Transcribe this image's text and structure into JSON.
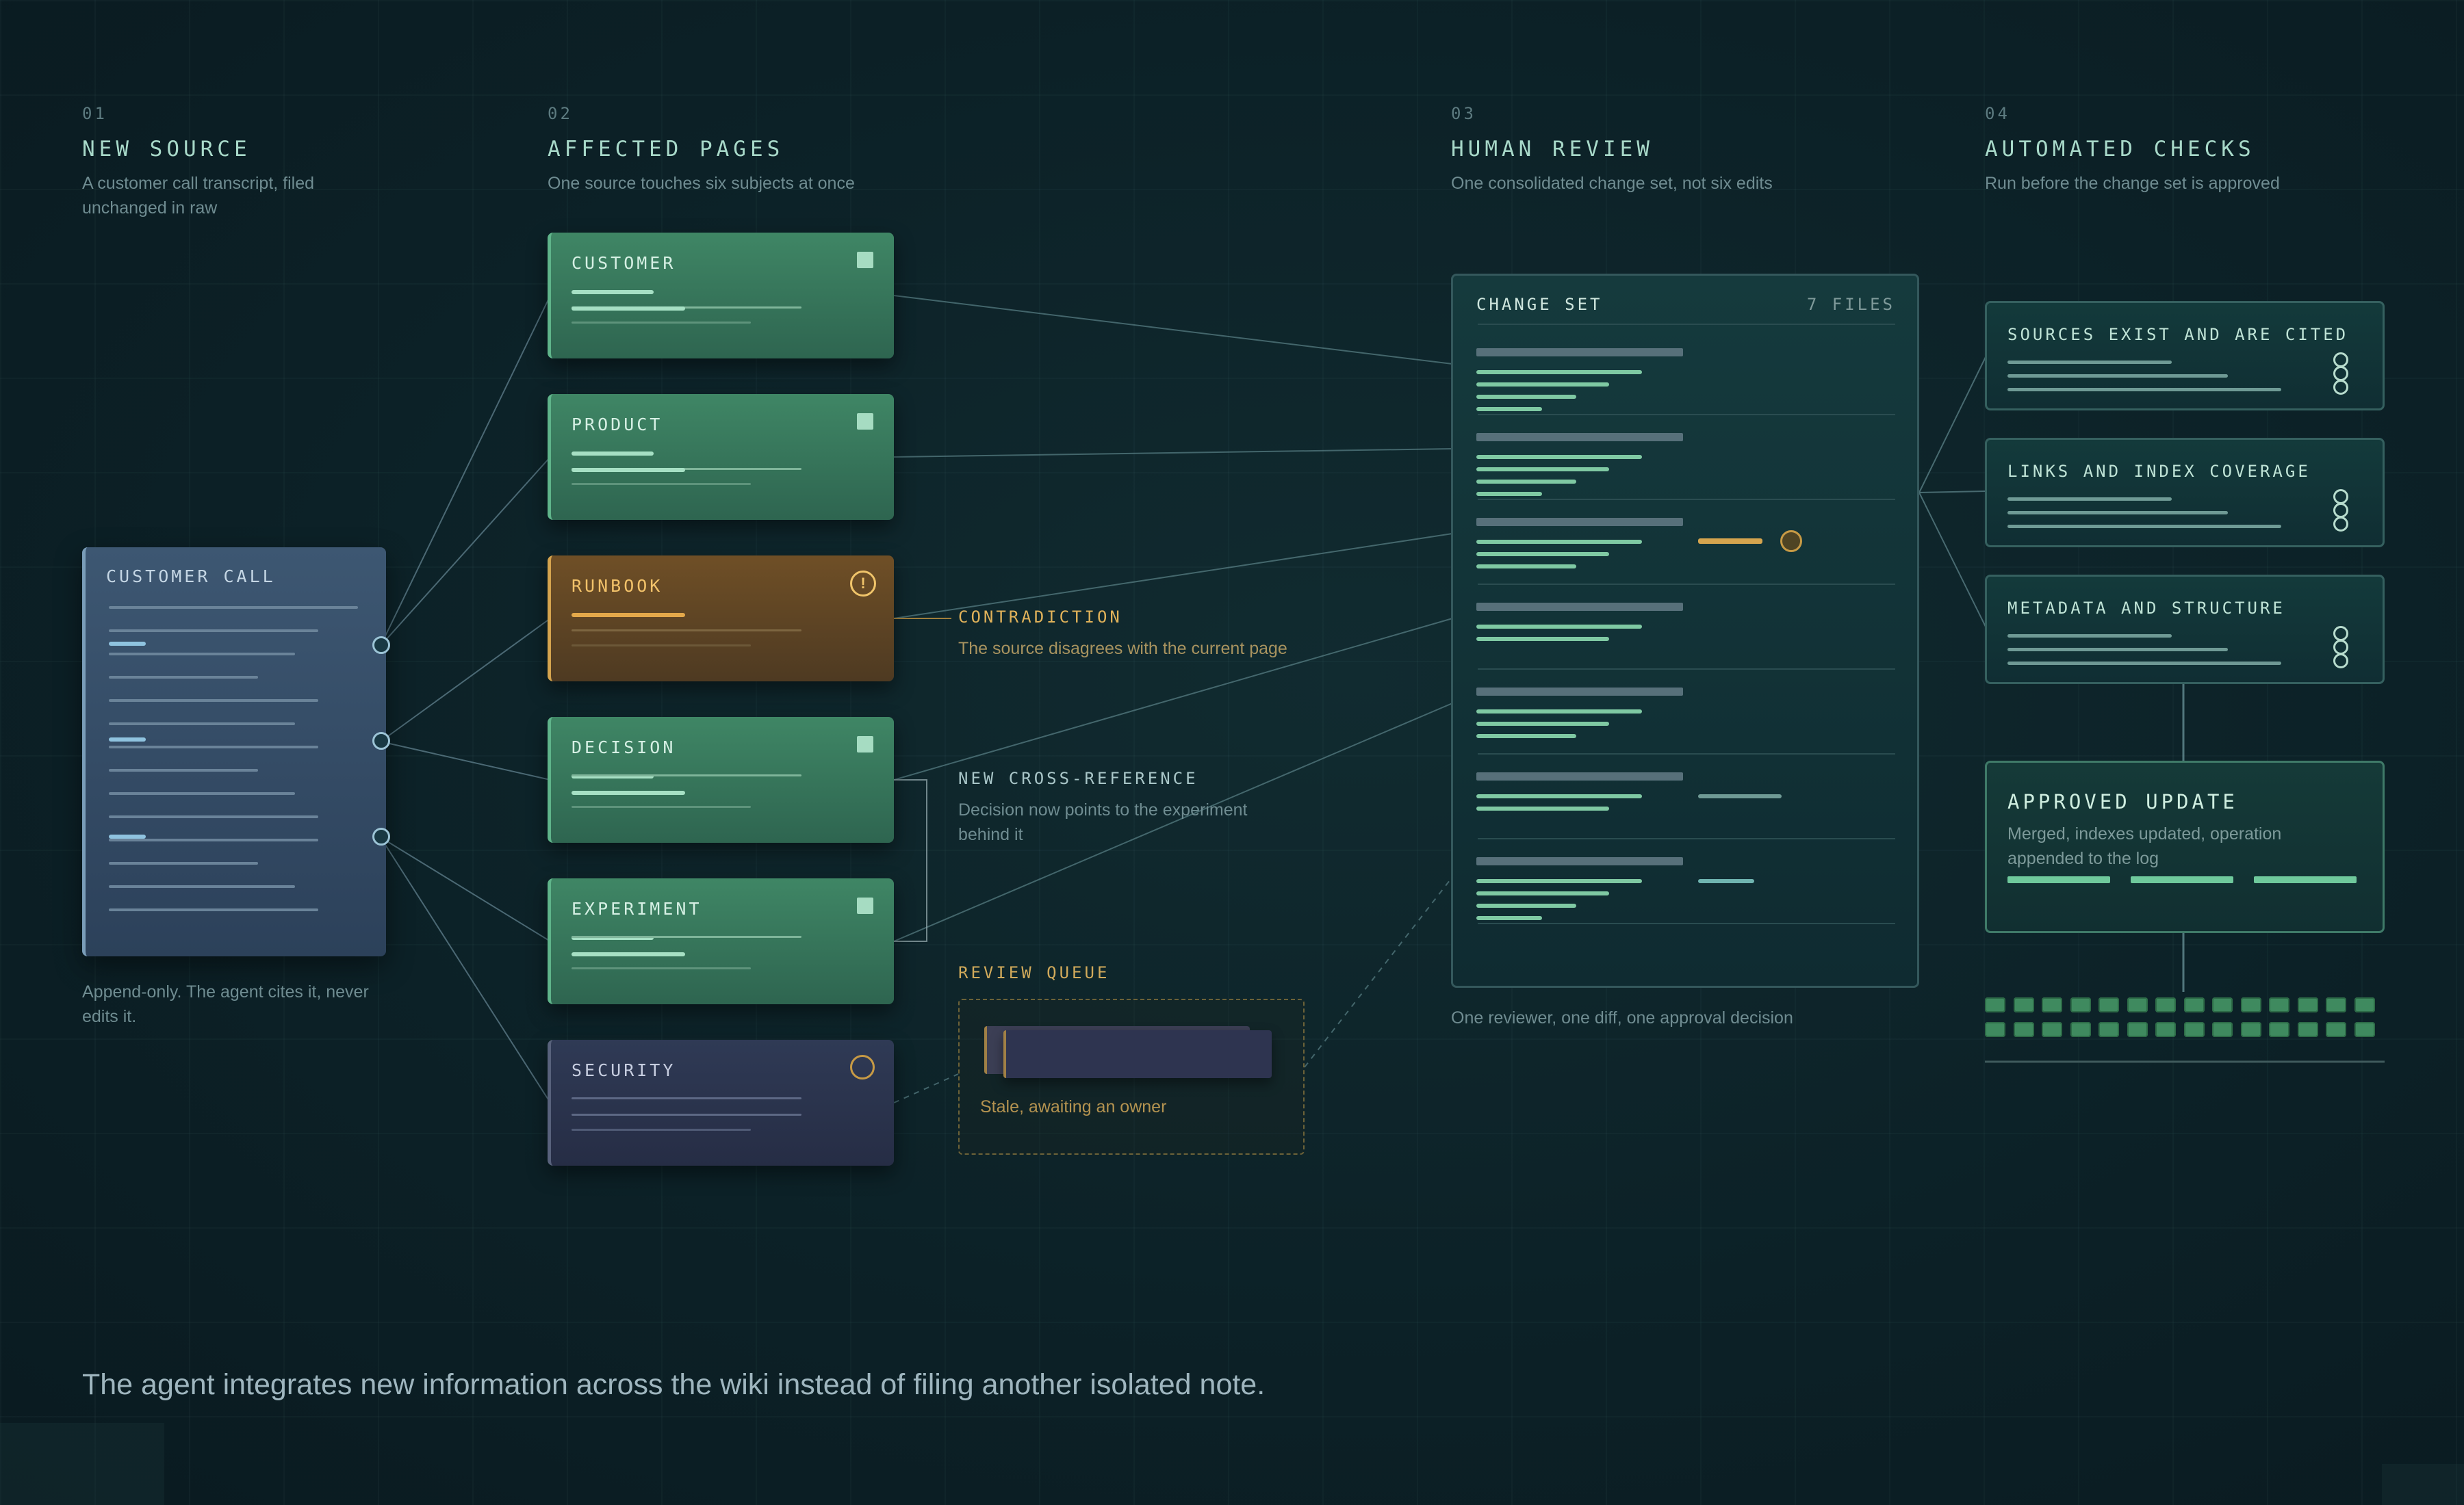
{
  "columns": [
    {
      "num": "01",
      "title": "NEW SOURCE",
      "desc": "A customer call transcript, filed unchanged in raw"
    },
    {
      "num": "02",
      "title": "AFFECTED PAGES",
      "desc": "One source touches six subjects at once"
    },
    {
      "num": "03",
      "title": "HUMAN REVIEW",
      "desc": "One consolidated change set, not six edits"
    },
    {
      "num": "04",
      "title": "AUTOMATED CHECKS",
      "desc": "Run before the change set is approved"
    }
  ],
  "source": {
    "title": "CUSTOMER CALL",
    "note": "Append-only. The agent cites it, never edits it."
  },
  "pages": [
    {
      "label": "CUSTOMER",
      "state": "updated",
      "icon": "square-icon"
    },
    {
      "label": "PRODUCT",
      "state": "updated",
      "icon": "square-icon"
    },
    {
      "label": "RUNBOOK",
      "state": "contradiction",
      "icon": "warning-icon"
    },
    {
      "label": "DECISION",
      "state": "updated",
      "icon": "square-icon"
    },
    {
      "label": "EXPERIMENT",
      "state": "updated",
      "icon": "square-icon"
    },
    {
      "label": "SECURITY",
      "state": "stale",
      "icon": "pending-circle-icon"
    }
  ],
  "annotations": {
    "contradiction": {
      "title": "CONTRADICTION",
      "desc": "The source disagrees with the current page"
    },
    "cross_reference": {
      "title": "NEW CROSS-REFERENCE",
      "desc": "Decision now points to the experiment behind it"
    },
    "review_queue": {
      "title": "REVIEW QUEUE",
      "desc": "Stale, awaiting an owner"
    }
  },
  "change_set": {
    "title": "CHANGE SET",
    "count": "7 FILES",
    "caption": "One reviewer, one diff, one approval decision"
  },
  "checks": [
    {
      "title": "SOURCES EXIST AND ARE CITED"
    },
    {
      "title": "LINKS AND INDEX COVERAGE"
    },
    {
      "title": "METADATA AND STRUCTURE"
    }
  ],
  "approved": {
    "title": "APPROVED UPDATE",
    "desc": "Merged, indexes updated, operation appended to the log"
  },
  "footer": {
    "caption": "The agent integrates new information across the wiki instead of filing another isolated note."
  },
  "colors": {
    "updated": "#3f8665",
    "contradiction": "#d5a44e",
    "stale": "#2f3a55",
    "accent_text": "#a8d9c9"
  }
}
